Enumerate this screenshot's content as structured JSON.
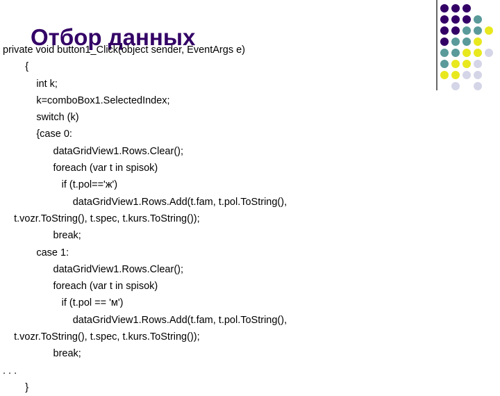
{
  "slide": {
    "title": "Отбор данных",
    "title_color": "#330066",
    "background": "#ffffff",
    "text_color": "#000000"
  },
  "code": {
    "language": "csharp",
    "lines": [
      "private void button1_Click(object sender, EventArgs e)",
      "        {",
      "            int k;",
      "            k=comboBox1.SelectedIndex;",
      "            switch (k)",
      "            {case 0:",
      "                  dataGridView1.Rows.Clear();",
      "                  foreach (var t in spisok)",
      "                     if (t.pol=='ж')",
      "                         dataGridView1.Rows.Add(t.fam, t.pol.ToString(),",
      "    t.vozr.ToString(), t.spec, t.kurs.ToString());",
      "                  break;",
      "            case 1:",
      "                  dataGridView1.Rows.Clear();",
      "                  foreach (var t in spisok)",
      "                     if (t.pol == 'м')",
      "                         dataGridView1.Rows.Add(t.fam, t.pol.ToString(),",
      "    t.vozr.ToString(), t.spec, t.kurs.ToString());",
      "                  break;",
      ". . .",
      "        }"
    ]
  },
  "decoration": {
    "name": "corner-dot-grid",
    "divider_color": "#666666",
    "palette": {
      "purple": "#330066",
      "teal": "#5a9a9a",
      "yellow": "#e8e81e",
      "lavender": "#d5d5e8"
    },
    "columns": 5,
    "rows": 8,
    "cell_size": 16,
    "dot_size": 12,
    "grid": [
      [
        "purple",
        "purple",
        "purple",
        null,
        null
      ],
      [
        "purple",
        "purple",
        "purple",
        "teal",
        null
      ],
      [
        "purple",
        "purple",
        "teal",
        "teal",
        "yellow"
      ],
      [
        "purple",
        "teal",
        "teal",
        "yellow",
        null
      ],
      [
        "teal",
        "teal",
        "yellow",
        "yellow",
        "lavender"
      ],
      [
        "teal",
        "yellow",
        "yellow",
        "lavender",
        null
      ],
      [
        "yellow",
        "yellow",
        "lavender",
        "lavender",
        null
      ],
      [
        null,
        "lavender",
        null,
        "lavender",
        null
      ]
    ]
  }
}
